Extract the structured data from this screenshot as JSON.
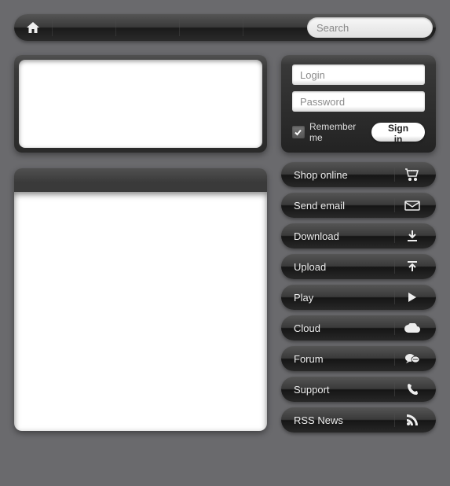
{
  "search": {
    "placeholder": "Search"
  },
  "login": {
    "login_placeholder": "Login",
    "password_placeholder": "Password",
    "remember_label": "Remember me",
    "signin_label": "Sign in",
    "remember_checked": true
  },
  "actions": [
    {
      "label": "Shop online",
      "icon": "cart"
    },
    {
      "label": "Send email",
      "icon": "envelope"
    },
    {
      "label": "Download",
      "icon": "download"
    },
    {
      "label": "Upload",
      "icon": "upload"
    },
    {
      "label": "Play",
      "icon": "play"
    },
    {
      "label": "Cloud",
      "icon": "cloud"
    },
    {
      "label": "Forum",
      "icon": "chat"
    },
    {
      "label": "Support",
      "icon": "phone"
    },
    {
      "label": "RSS News",
      "icon": "rss"
    }
  ]
}
